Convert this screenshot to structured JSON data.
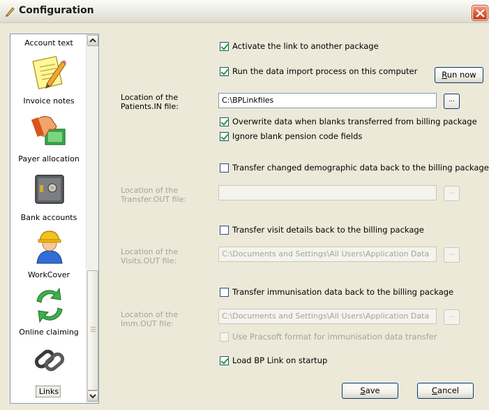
{
  "window": {
    "title": "Configuration"
  },
  "sidebar": {
    "items": [
      {
        "label": "Account text",
        "icon": "account-text-icon"
      },
      {
        "label": "Invoice notes",
        "icon": "notepad-pencil-icon"
      },
      {
        "label": "Payer allocation",
        "icon": "hand-money-icon"
      },
      {
        "label": "Bank accounts",
        "icon": "safe-icon"
      },
      {
        "label": "WorkCover",
        "icon": "worker-hardhat-icon"
      },
      {
        "label": "Online claiming",
        "icon": "green-arrows-cycle-icon"
      },
      {
        "label": "Links",
        "icon": "chain-link-icon"
      }
    ]
  },
  "form": {
    "activate_link": {
      "label": "Activate the link to another package",
      "checked": true
    },
    "run_import": {
      "label": "Run the data import process on this computer",
      "checked": true
    },
    "run_now": {
      "prefix": "",
      "accel": "R",
      "rest": "un now"
    },
    "patients_in": {
      "label_1": "Location of the",
      "label_2": "Patients.IN file:",
      "value": "C:\\BPLinkfiles"
    },
    "overwrite_blanks": {
      "label": "Overwrite data when blanks transferred from billing package",
      "checked": true
    },
    "ignore_pension": {
      "label": "Ignore blank pension code fields",
      "checked": true
    },
    "transfer_demographic": {
      "label": "Transfer changed demographic data back to the billing package",
      "checked": false
    },
    "transfer_out": {
      "label_1": "Location of the",
      "label_2": "Transfer.OUT file:",
      "value": ""
    },
    "transfer_visits": {
      "label": "Transfer visit details back to the billing package",
      "checked": false
    },
    "visits_out": {
      "label_1": "Location of the",
      "label_2": "Visits.OUT file:",
      "value": "C:\\Documents and Settings\\All Users\\Application Data"
    },
    "transfer_immunisation": {
      "label": "Transfer immunisation data back to the billing package",
      "checked": false
    },
    "imm_out": {
      "label_1": "Location of the",
      "label_2": "Imm.OUT file:",
      "value": "C:\\Documents and Settings\\All Users\\Application Data"
    },
    "use_pracsoft": {
      "label": "Use Pracsoft format for immunisation data transfer",
      "checked": false
    },
    "load_on_startup": {
      "label": "Load BP Link on startup",
      "checked": true
    },
    "browse_label": "...",
    "save": {
      "accel": "S",
      "rest": "ave"
    },
    "cancel": {
      "accel": "C",
      "rest": "ancel"
    }
  },
  "colors": {
    "accent_check": "#21a121",
    "border": "#7f9db9",
    "window_bg": "#ece9d8"
  }
}
